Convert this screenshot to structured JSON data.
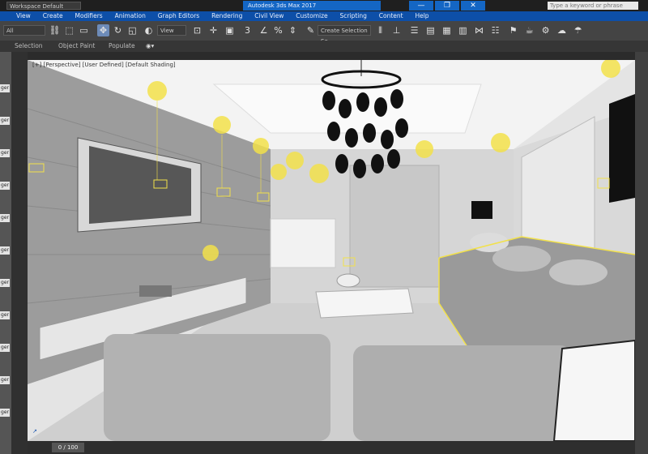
{
  "window": {
    "workspace_label": "Workspace Default",
    "title": "Autodesk 3ds Max 2017",
    "search_placeholder": "Type a keyword or phrase",
    "accent_color": "#1466c4",
    "controls": [
      "—",
      "❐",
      "✕"
    ]
  },
  "menu": [
    "View",
    "Create",
    "Modifiers",
    "Animation",
    "Graph Editors",
    "Rendering",
    "Civil View",
    "Customize",
    "Scripting",
    "Content",
    "Help"
  ],
  "toolbar": {
    "filter_value": "All",
    "refcoord_value": "View",
    "selection_set_placeholder": "Create Selection Se"
  },
  "ribbon": {
    "tabs": [
      "Selection",
      "Object Paint",
      "Populate"
    ]
  },
  "viewport": {
    "label": "[+] [Perspective] [User Defined] [Default Shading]",
    "light_color": "#f2e14a"
  },
  "left_panel": {
    "item_suffix": "ger"
  },
  "timeline": {
    "frame": "0 / 100"
  }
}
